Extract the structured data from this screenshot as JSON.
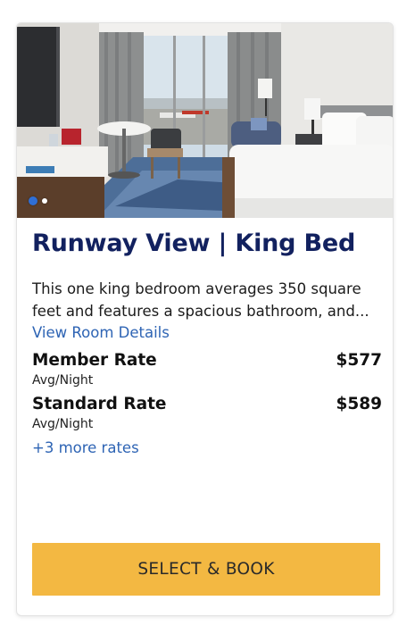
{
  "room": {
    "title": "Runway View | King Bed",
    "description": "This one king bedroom averages 350 square feet and features a spacious bathroom, and...",
    "details_link": "View Room Details"
  },
  "carousel": {
    "total_images": 2,
    "active_index": 0
  },
  "rates": [
    {
      "name": "Member Rate",
      "price": "$577",
      "period": "Avg/Night"
    },
    {
      "name": "Standard Rate",
      "price": "$589",
      "period": "Avg/Night"
    }
  ],
  "more_rates_link": "+3 more rates",
  "book_button": "SELECT & BOOK",
  "colors": {
    "title": "#12215f",
    "link": "#2e64b4",
    "button": "#f3b842",
    "active_dot": "#2f6fd6"
  }
}
